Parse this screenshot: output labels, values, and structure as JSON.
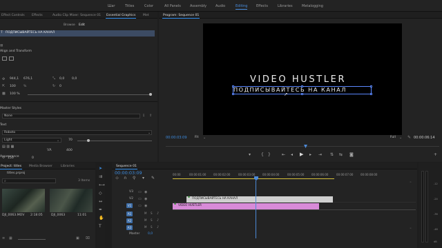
{
  "workspaces": [
    {
      "label": "Шаг"
    },
    {
      "label": "Titles"
    },
    {
      "label": "Color"
    },
    {
      "label": "All Panels"
    },
    {
      "label": "Assembly"
    },
    {
      "label": "Audio"
    },
    {
      "label": "Editing"
    },
    {
      "label": "Effects"
    },
    {
      "label": "Libraries"
    },
    {
      "label": "Metalogging"
    }
  ],
  "workspace_active": "Editing",
  "left_panel": {
    "tabs": [
      "Effect Controls",
      "Effects",
      "Audio Clip Mixer: Sequence 01",
      "Essential Graphics",
      "Met"
    ],
    "active_tab": "Essential Graphics",
    "sub_tabs": [
      "Browse",
      "Edit"
    ],
    "layer_name": "ПОДПИСЫВАЙТЕСЬ НА КАНАЛ",
    "align_label": "Align and Transform",
    "position_x": "944,1",
    "position_y": "676,1",
    "anchor_x": "0,0",
    "anchor_y": "0,0",
    "scale": "100",
    "scale_unit": "%",
    "rotation": "0",
    "opacity": "100 %",
    "master_styles_label": "Master Styles",
    "master_styles_value": "None",
    "text_label": "Text",
    "font": "Roboto",
    "font_style": "Light",
    "font_size": "70",
    "tracking": "400",
    "leading_value": "150",
    "leading_value2": "0",
    "appearance_label": "Appearance"
  },
  "program_monitor": {
    "title": "Program: Sequence 01",
    "video_title": "VIDEO HUSTLER",
    "video_subtitle": "ПОДПИСЫВАЙТЕСЬ НА КАНАЛ",
    "timecode_current": "00:00:03:09",
    "fit": "Fit",
    "quality": "Full",
    "timecode_total": "00:00:06:14"
  },
  "project_panel": {
    "tabs": [
      "Project: titles",
      "Media Browser",
      "Libraries"
    ],
    "project_file": "titles.prproj",
    "item_count": "3 Items",
    "items": [
      {
        "name": "DJI_0063.MOV",
        "duration": "2:18:05"
      },
      {
        "name": "DJI_0063",
        "duration": "11:01"
      }
    ]
  },
  "timeline": {
    "title": "Sequence 01",
    "timecode": "00:00:03:09",
    "ruler": [
      "00:00",
      "00:00:01:00",
      "00:00:02:00",
      "00:00:03:00",
      "00:00:04:00",
      "00:00:05:00",
      "00:00:06:00",
      "00:00:07:00",
      "00:00:08:00"
    ],
    "tracks": [
      {
        "id": "V3"
      },
      {
        "id": "V2"
      },
      {
        "id": "V1"
      },
      {
        "id": "A1"
      },
      {
        "id": "A2"
      },
      {
        "id": "A3"
      }
    ],
    "master_label": "Master",
    "master_value": "0,0",
    "clips": [
      {
        "label": "ПОДПИСЫВАЙТЕСЬ НА КАНАЛ",
        "track": "V2"
      },
      {
        "label": "VIDEO HUSTLER",
        "track": "V1"
      }
    ]
  },
  "meters": {
    "labels": [
      "-12",
      "-24",
      "-36",
      "-48",
      "dB"
    ]
  },
  "colors": {
    "accent_blue": "#2d8ceb",
    "clip_pink": "#d88bd8",
    "clip_grey": "#cfcfcf",
    "playhead": "#4d8ad8"
  }
}
